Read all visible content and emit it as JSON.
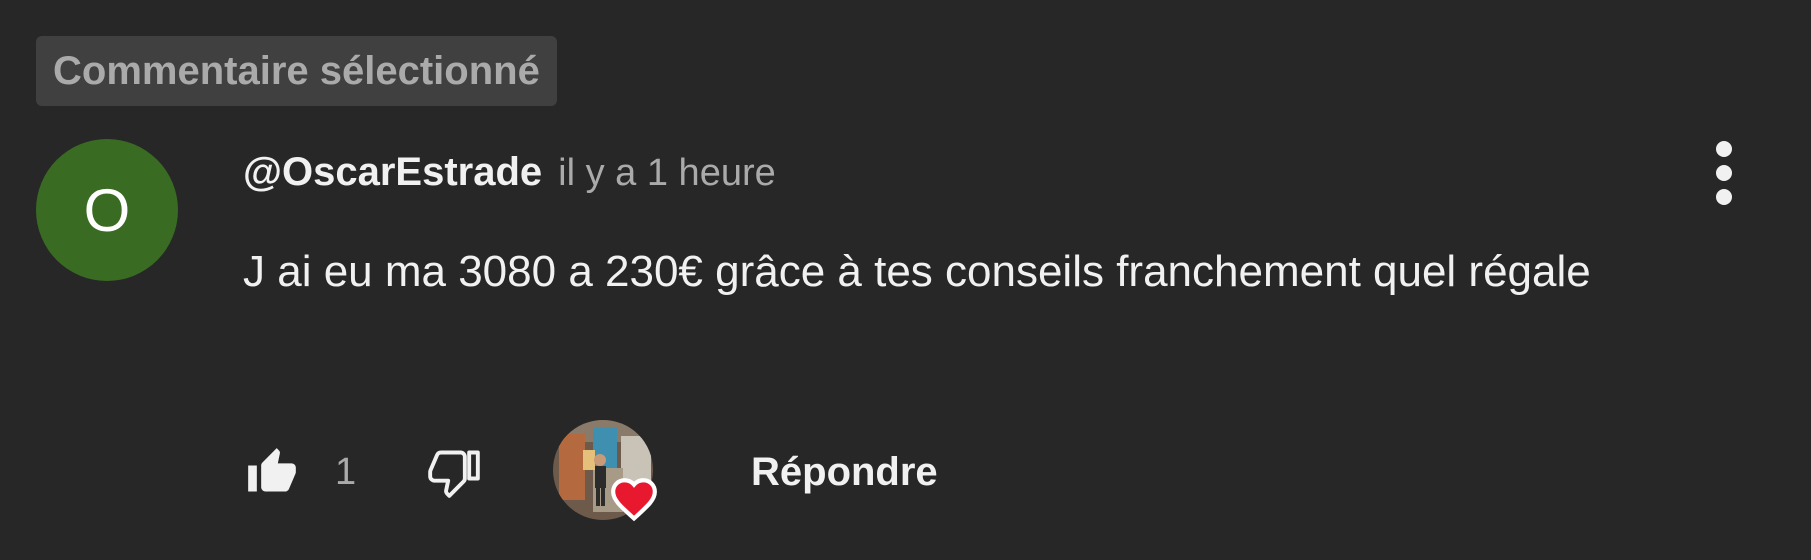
{
  "header": {
    "selected_label": "Commentaire sélectionné"
  },
  "comment": {
    "avatar_letter": "O",
    "avatar_color": "#3a6b22",
    "author": "@OscarEstrade",
    "timestamp": "il y a 1 heure",
    "text": "J ai eu ma 3080 a 230€ grâce à tes conseils franchement quel régale",
    "like_count": "1",
    "reply_label": "Répondre",
    "creator_heart_color": "#e8182e"
  },
  "icons": {
    "more": "vertical-dots-icon",
    "like": "thumbs-up-icon",
    "dislike": "thumbs-down-icon",
    "heart": "heart-icon"
  }
}
